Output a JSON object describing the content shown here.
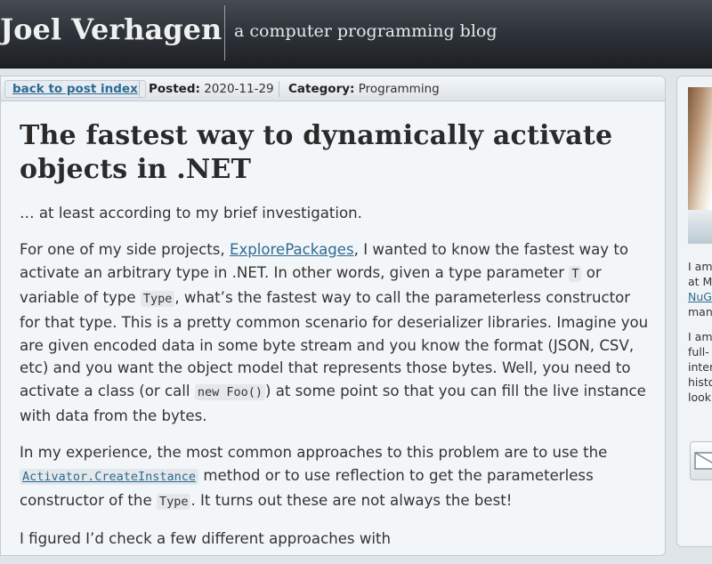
{
  "header": {
    "site_title": "Joel Verhagen",
    "tagline": "a computer programming blog"
  },
  "meta": {
    "back_link": "back to post index",
    "posted_label": "Posted:",
    "posted_value": "2020-11-29",
    "category_label": "Category:",
    "category_value": "Programming"
  },
  "post": {
    "title": "The fastest way to dynamically activate objects in .NET",
    "intro": "… at least according to my brief investigation.",
    "p1": {
      "a": "For one of my side projects, ",
      "link": "ExplorePackages",
      "b": ", I wanted to know the fastest way to activate an arbitrary type in .NET. In other words, given a type parameter ",
      "code1": "T",
      "c": " or variable of type ",
      "code2": "Type",
      "d": ", what’s the fastest way to call the parameterless constructor for that type. This is a pretty common scenario for deserializer libraries. Imagine you are given encoded data in some byte stream and you know the format (JSON, CSV, etc) and you want the object model that represents those bytes. Well, you need to activate a class (or call ",
      "code3": "new Foo()",
      "e": ") at some point so that you can fill the live instance with data from the bytes."
    },
    "p2": {
      "a": "In my experience, the most common approaches to this problem are to use the ",
      "link_code": "Activator.CreateInstance",
      "b": " method or to use reflection to get the parameterless constructor of the ",
      "code": "Type",
      "c": ". It turns out these are not always the best!"
    },
    "p3_partial": "I figured I’d check a few different approaches with"
  },
  "sidebar": {
    "line1": "I am",
    "line2": "at M",
    "line3_link": "NuG",
    "line4": "man",
    "line5": "I am",
    "line6": "full-",
    "line7": "inter",
    "line8": "histo",
    "line9": "look"
  },
  "icons": {
    "email": "envelope-icon"
  },
  "colors": {
    "link": "#2e6a92",
    "header_bg": "#30353b",
    "page_bg": "#dfe5e9",
    "content_bg": "#f3f6f8"
  }
}
